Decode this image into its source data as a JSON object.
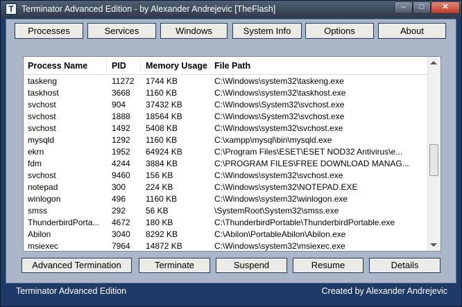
{
  "window": {
    "title": "Terminator Advanced Edition - by Alexander Andrejevic [TheFlash]",
    "icon_letter": "T",
    "minimize": "–",
    "maximize": "□",
    "close": "✕"
  },
  "nav": [
    "Processes",
    "Services",
    "Windows",
    "System Info",
    "Options",
    "About"
  ],
  "columns": [
    "Process Name",
    "PID",
    "Memory Usage",
    "File Path"
  ],
  "rows": [
    [
      "taskeng",
      "11272",
      "1744 KB",
      "C:\\Windows\\system32\\taskeng.exe"
    ],
    [
      "taskhost",
      "3668",
      "1160 KB",
      "C:\\Windows\\system32\\taskhost.exe"
    ],
    [
      "svchost",
      "904",
      "37432 KB",
      "C:\\Windows\\System32\\svchost.exe"
    ],
    [
      "svchost",
      "1888",
      "18564 KB",
      "C:\\Windows\\System32\\svchost.exe"
    ],
    [
      "svchost",
      "1492",
      "5408 KB",
      "C:\\Windows\\system32\\svchost.exe"
    ],
    [
      "mysqld",
      "1292",
      "1160 KB",
      "C:\\xampp\\mysql\\bin\\mysqld.exe"
    ],
    [
      "ekrn",
      "1952",
      "64924 KB",
      "C:\\Program Files\\ESET\\ESET NOD32 Antivirus\\e..."
    ],
    [
      "fdm",
      "4244",
      "3884 KB",
      "C:\\PROGRAM FILES\\FREE DOWNLOAD MANAG..."
    ],
    [
      "svchost",
      "9460",
      "156 KB",
      "C:\\Windows\\system32\\svchost.exe"
    ],
    [
      "notepad",
      "300",
      "224 KB",
      "C:\\Windows\\system32\\NOTEPAD.EXE"
    ],
    [
      "winlogon",
      "496",
      "1160 KB",
      "C:\\Windows\\system32\\winlogon.exe"
    ],
    [
      "smss",
      "292",
      "56 KB",
      "\\SystemRoot\\System32\\smss.exe"
    ],
    [
      "ThunderbirdPorta...",
      "4672",
      "180 KB",
      "C:\\ThunderbirdPortable\\ThunderbirdPortable.exe"
    ],
    [
      "Abilon",
      "3040",
      "8292 KB",
      "C:\\Abilon\\PortableAbilon\\Abilon.exe"
    ],
    [
      "msiexec",
      "7964",
      "14872 KB",
      "C:\\Windows\\system32\\msiexec.exe"
    ]
  ],
  "actions": [
    "Advanced Termination",
    "Terminate",
    "Suspend",
    "Resume",
    "Details"
  ],
  "status": {
    "left": "Terminator Advanced Edition",
    "right": "Created by Alexander Andrejevic"
  }
}
